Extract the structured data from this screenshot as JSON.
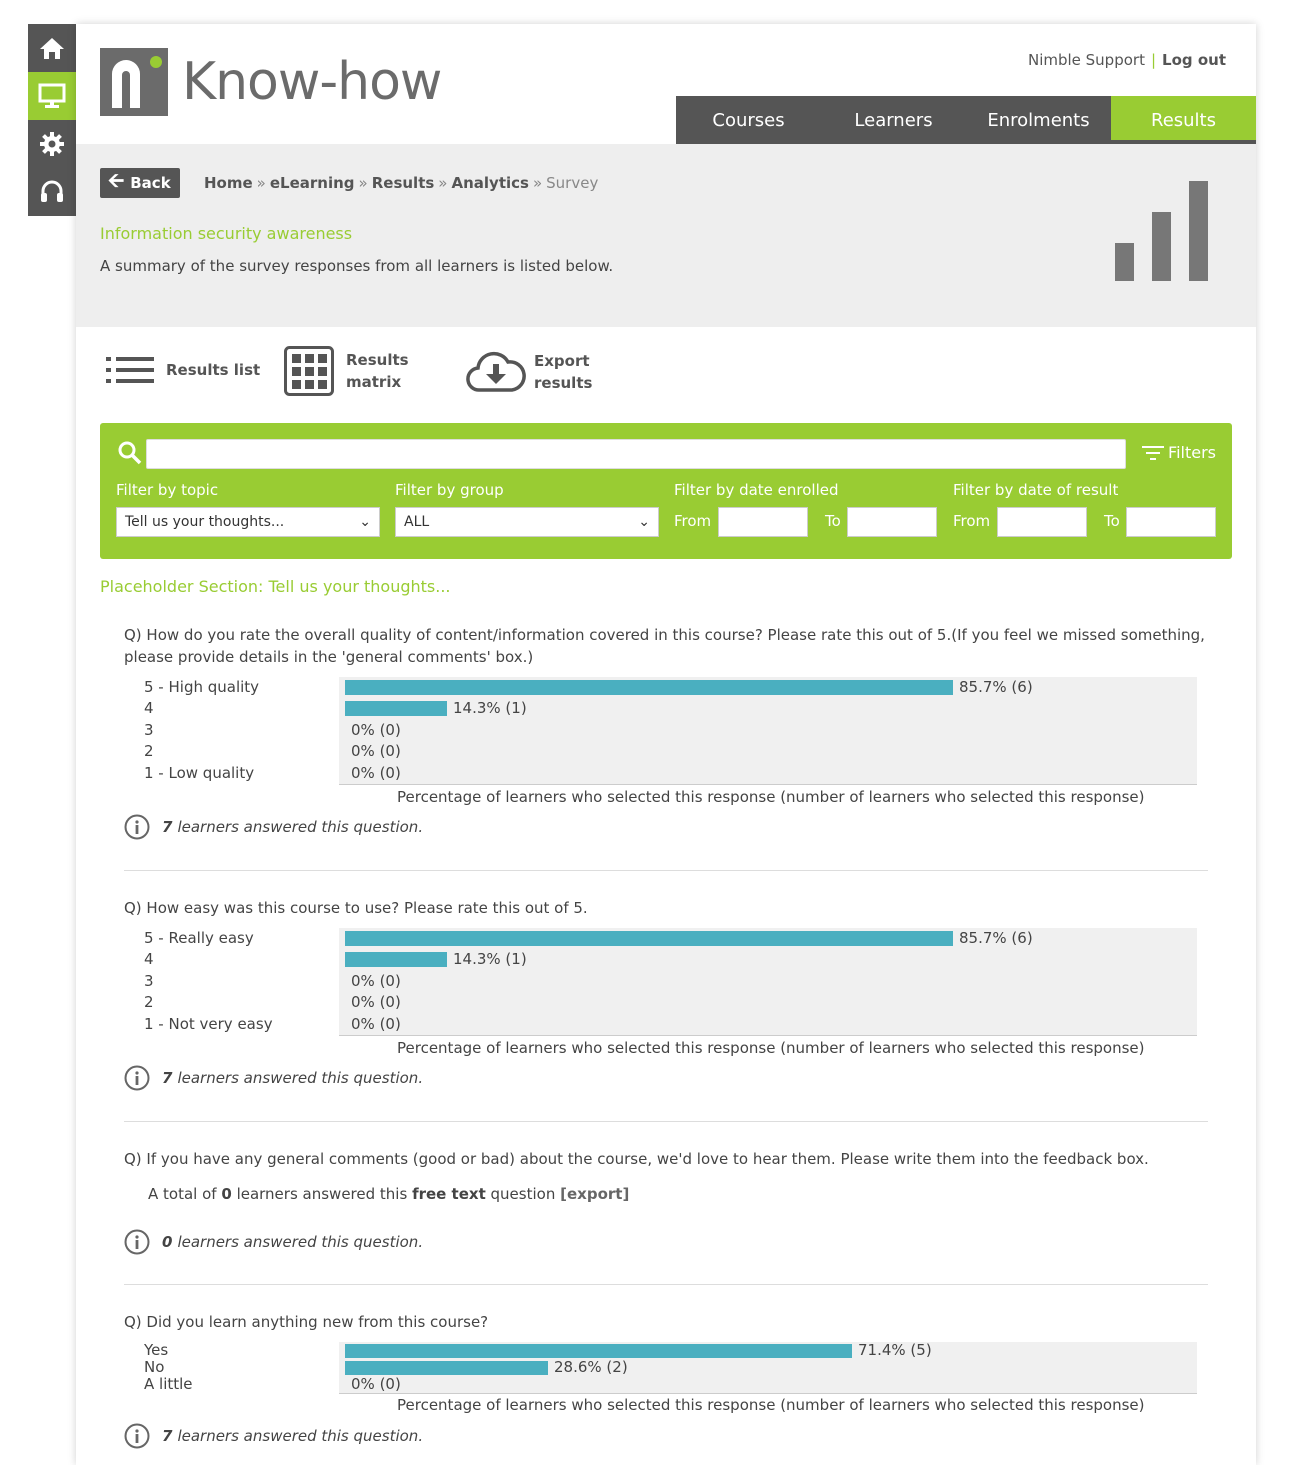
{
  "top_links": {
    "support": "Nimble Support",
    "separator": "|",
    "logout": "Log out"
  },
  "brand": "Know-how",
  "nav": [
    {
      "label": "Courses"
    },
    {
      "label": "Learners"
    },
    {
      "label": "Enrolments"
    },
    {
      "label": "Results",
      "active": true
    }
  ],
  "back_label": "Back",
  "breadcrumb": [
    "Home",
    "eLearning",
    "Results",
    "Analytics",
    "Survey"
  ],
  "course_title": "Information security awareness",
  "page_desc": "A summary of the survey responses from all learners is listed below.",
  "tools": {
    "list": "Results list",
    "matrix_1": "Results",
    "matrix_2": "matrix",
    "export_1": "Export",
    "export_2": "results"
  },
  "filters": {
    "button": "Filters",
    "topic_label": "Filter by topic",
    "topic_value": "Tell us your thoughts...",
    "group_label": "Filter by group",
    "group_value": "ALL",
    "enrolled_label": "Filter by date enrolled",
    "result_label": "Filter by date of result",
    "from": "From",
    "to": "To"
  },
  "section_title": "Placeholder Section: Tell us your thoughts...",
  "axis_label": "Percentage of learners who selected this response (number of learners who selected this response)",
  "questions": [
    {
      "text": "Q) How do you rate the overall quality of content/information covered in this course? Please rate this out of 5.(If you feel we missed something, please provide details in the 'general comments' box.)",
      "options": [
        {
          "label": "5 - High quality",
          "pct": 85.7,
          "value": "85.7% (6)"
        },
        {
          "label": "4",
          "pct": 14.3,
          "value": "14.3% (1)"
        },
        {
          "label": "3",
          "pct": 0,
          "value": "0% (0)"
        },
        {
          "label": "2",
          "pct": 0,
          "value": "0% (0)"
        },
        {
          "label": "1 - Low quality",
          "pct": 0,
          "value": "0% (0)"
        }
      ],
      "answered_count": "7",
      "answered_text": "learners answered this question."
    },
    {
      "text": "Q) How easy was this course to use? Please rate this out of 5.",
      "options": [
        {
          "label": "5 - Really easy",
          "pct": 85.7,
          "value": "85.7% (6)"
        },
        {
          "label": "4",
          "pct": 14.3,
          "value": "14.3% (1)"
        },
        {
          "label": "3",
          "pct": 0,
          "value": "0% (0)"
        },
        {
          "label": "2",
          "pct": 0,
          "value": "0% (0)"
        },
        {
          "label": "1 - Not very easy",
          "pct": 0,
          "value": "0% (0)"
        }
      ],
      "answered_count": "7",
      "answered_text": "learners answered this question."
    },
    {
      "text": "Q) If you have any general comments (good or bad) about the course, we'd love to hear them. Please write them into the feedback box.",
      "free_text": {
        "a_total_of": "A total of",
        "count": "0",
        "middle": "learners answered this",
        "kind": "free text",
        "question": "question",
        "export": "[export]"
      },
      "answered_count": "0",
      "answered_text": "learners answered this question."
    },
    {
      "text": "Q) Did you learn anything new from this course?",
      "options": [
        {
          "label": "Yes",
          "pct": 71.4,
          "value": "71.4% (5)"
        },
        {
          "label": "No",
          "pct": 28.6,
          "value": "28.6% (2)"
        },
        {
          "label": "A little",
          "pct": 0,
          "value": "0% (0)"
        }
      ],
      "answered_count": "7",
      "answered_text": "learners answered this question."
    }
  ],
  "colors": {
    "accent": "#99cc33",
    "dark": "#555555",
    "bar": "#4aafc0",
    "bg_grey": "#eeeeee"
  }
}
